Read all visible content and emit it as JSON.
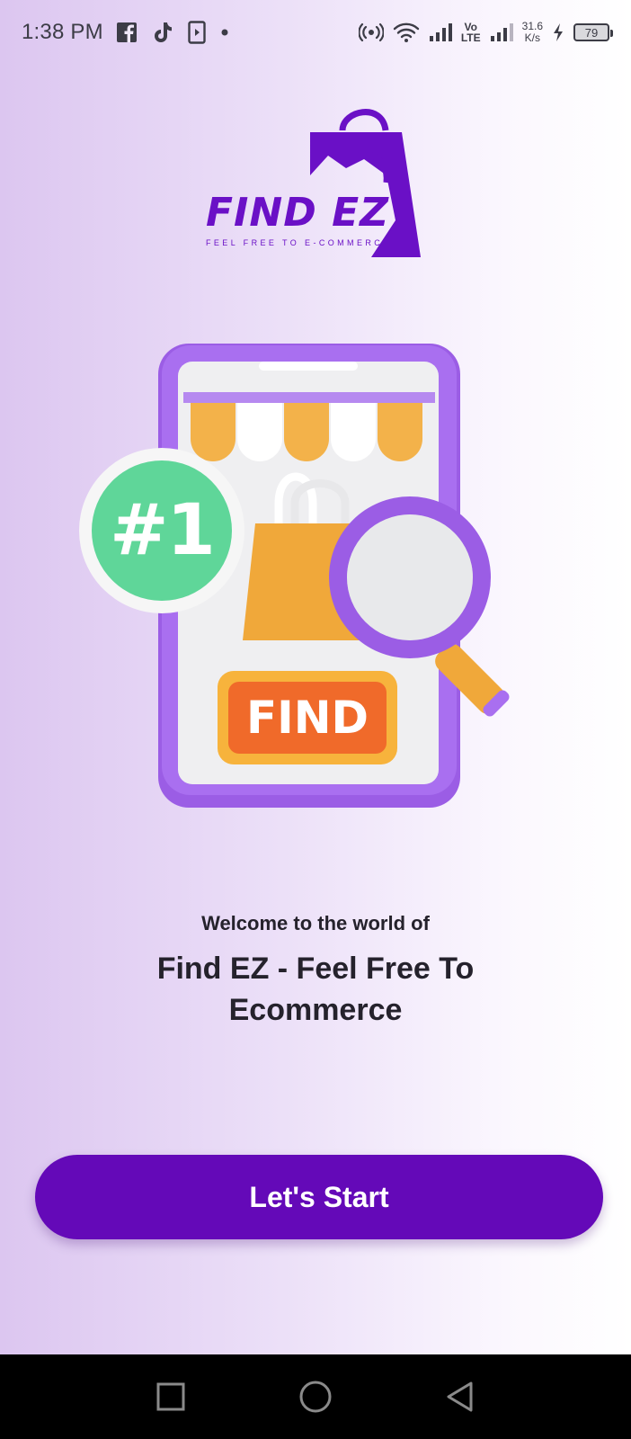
{
  "status_bar": {
    "time": "1:38 PM",
    "net_speed_value": "31.6",
    "net_speed_unit": "K/s",
    "lte_top": "Vo",
    "lte_bottom": "LTE",
    "battery": "79",
    "icons": [
      "facebook-icon",
      "tiktok-icon",
      "media-icon",
      "dot-icon",
      "hotspot-icon",
      "wifi-icon",
      "signal-icon",
      "charging-icon",
      "battery-icon"
    ]
  },
  "logo": {
    "name": "FIND EZ",
    "tagline": "FEEL FREE TO E-COMMERCE"
  },
  "illustration": {
    "badge_text": "#1",
    "find_button_text": "FIND"
  },
  "welcome": {
    "subtitle": "Welcome to the world of",
    "title": "Find EZ - Feel Free To Ecommerce"
  },
  "cta": {
    "label": "Let's Start"
  },
  "nav": {
    "icons": [
      "recents-icon",
      "home-icon",
      "back-icon"
    ]
  },
  "colors": {
    "brand_purple": "#6409b8",
    "logo_purple": "#6a10c6",
    "phone_frame": "#9b5de5",
    "badge_green": "#5fd699",
    "orange": "#f0a83a",
    "find_orange": "#f06a2a"
  }
}
